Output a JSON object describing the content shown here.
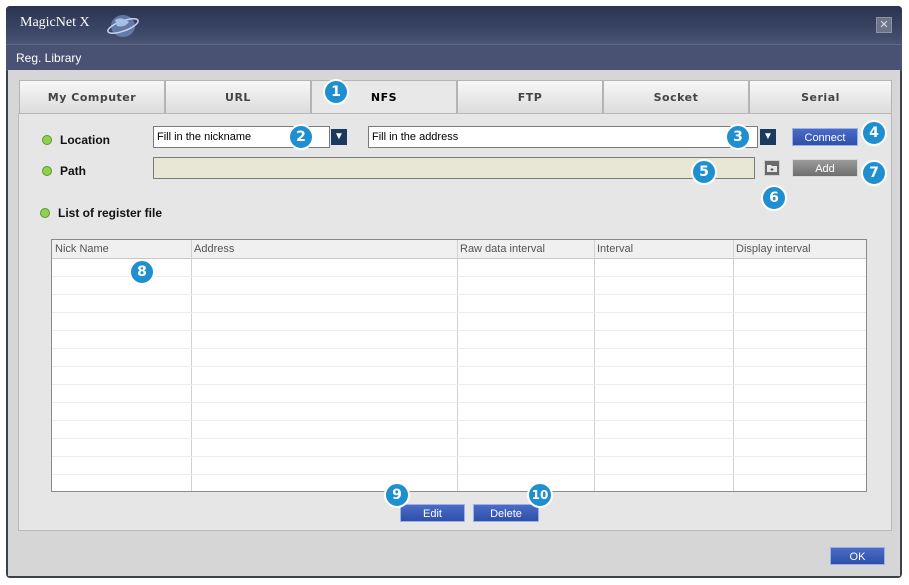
{
  "window": {
    "app_name": "MagicNet X",
    "close_symbol": "✕",
    "subtitle": "Reg. Library"
  },
  "tabs": [
    {
      "label": "My Computer"
    },
    {
      "label": "URL"
    },
    {
      "label": "NFS"
    },
    {
      "label": "FTP"
    },
    {
      "label": "Socket"
    },
    {
      "label": "Serial"
    }
  ],
  "active_tab": "NFS",
  "form": {
    "location_label": "Location",
    "nickname_value": "Fill in the nickname",
    "address_value": "Fill in the address",
    "connect_label": "Connect",
    "path_label": "Path",
    "path_value": "",
    "add_label": "Add",
    "list_title": "List of register file"
  },
  "table": {
    "columns": [
      "Nick Name",
      "Address",
      "Raw data interval",
      "Interval",
      "Display interval"
    ],
    "rows": []
  },
  "actions": {
    "edit_label": "Edit",
    "delete_label": "Delete",
    "ok_label": "OK"
  },
  "badges": [
    "1",
    "2",
    "3",
    "4",
    "5",
    "6",
    "7",
    "8",
    "9",
    "10"
  ],
  "colors": {
    "accent_blue": "#2f4fa8",
    "badge": "#1f8fd0",
    "status_dot": "#8fd14f",
    "path_field": "#e8e6d4"
  },
  "icons": {
    "dropdown": "chevron-down-icon",
    "folder": "folder-icon",
    "globe": "globe-icon",
    "close": "close-icon"
  }
}
